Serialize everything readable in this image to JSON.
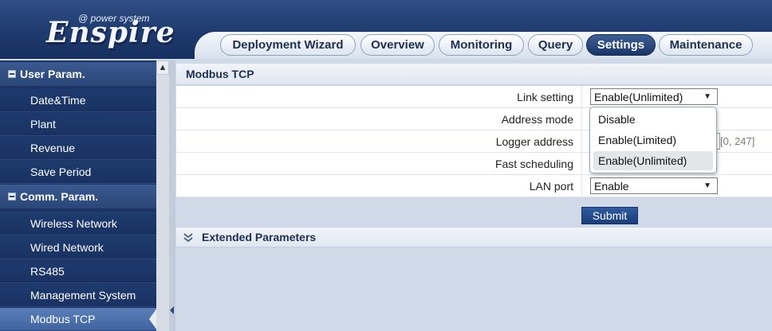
{
  "brand": {
    "name": "Enspire",
    "tagline": "@ power system"
  },
  "tabs": [
    {
      "label": "Deployment Wizard",
      "active": false
    },
    {
      "label": "Overview",
      "active": false
    },
    {
      "label": "Monitoring",
      "active": false
    },
    {
      "label": "Query",
      "active": false
    },
    {
      "label": "Settings",
      "active": true
    },
    {
      "label": "Maintenance",
      "active": false
    }
  ],
  "sidebar": {
    "groups": [
      {
        "label": "User Param.",
        "items": [
          "Date&Time",
          "Plant",
          "Revenue",
          "Save Period"
        ]
      },
      {
        "label": "Comm. Param.",
        "items": [
          "Wireless Network",
          "Wired Network",
          "RS485",
          "Management System",
          "Modbus TCP"
        ]
      }
    ],
    "active_item": "Modbus TCP"
  },
  "section": {
    "title": "Modbus TCP",
    "rows": [
      {
        "label": "Link setting",
        "value": "Enable(Unlimited)"
      },
      {
        "label": "Address mode",
        "value": ""
      },
      {
        "label": "Logger address",
        "value": "",
        "hint": "[0, 247]"
      },
      {
        "label": "Fast scheduling",
        "value": ""
      },
      {
        "label": "LAN port",
        "value": "Enable"
      }
    ],
    "dropdown_options": [
      "Disable",
      "Enable(Limited)",
      "Enable(Unlimited)"
    ],
    "dropdown_selected": "Enable(Unlimited)",
    "submit_label": "Submit",
    "extended_title": "Extended Parameters"
  },
  "colors": {
    "header": "#1f3a6e",
    "sidebar": "#1c3566",
    "active_tab": "#1a3668",
    "background": "#cfd9e8"
  }
}
